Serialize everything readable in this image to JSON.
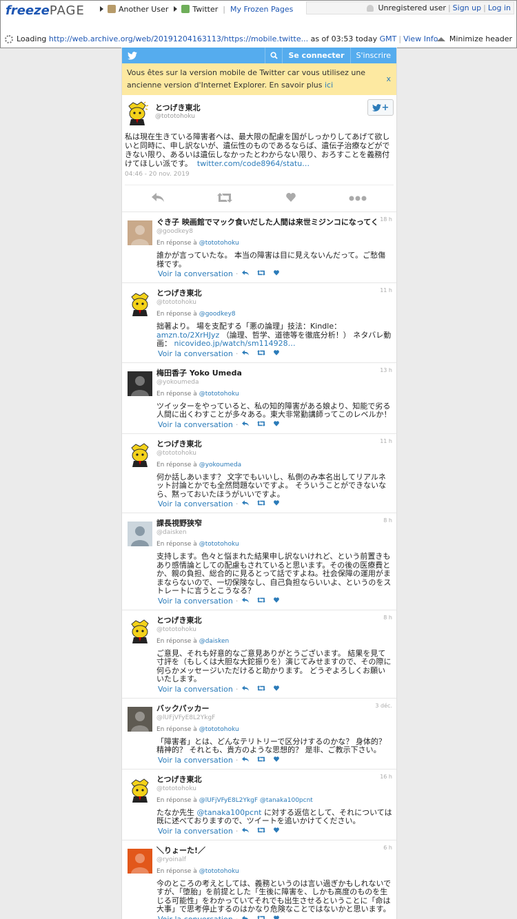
{
  "freezepage": {
    "logo_freeze": "freeze",
    "logo_page": "PAGE",
    "nav_user": "Another User",
    "nav_site": "Twitter",
    "nav_my": "My Frozen Pages",
    "user_status": "Unregistered user",
    "sign_up": "Sign up",
    "log_in": "Log in",
    "loading_label": "Loading",
    "loading_url": "http://web.archive.org/web/20191204163113/https://mobile.twitte...",
    "as_of": "as of 03:53 today",
    "gmt": "GMT",
    "view_info": "View Info",
    "minimize": "Minimize header"
  },
  "twitter": {
    "login": "Se connecter",
    "signup": "S'inscrire",
    "notice_text": "Vous êtes sur la version mobile de Twitter car vous utilisez une ancienne version d'Internet Explorer. En savoir plus",
    "notice_link": "ici",
    "notice_close": "x",
    "accent": "#55acee"
  },
  "main_tweet": {
    "name": "とつげき東北",
    "handle": "@tototohoku",
    "text": "私は現在生きている障害者へは、最大限の配慮を国がしっかりしてあげて欲しいと同時に、申し訳ないが、遺伝性のものであるならば、遺伝子治療などができない限り、あるいは遺伝しなかったとわからない限り、おろすことを義務付けてほしい派です。",
    "link": "twitter.com/code8964/statu…",
    "date": "04:46 - 20 nov. 2019"
  },
  "common": {
    "in_reply": "En réponse à",
    "view_conv": "Voir la conversation",
    "dot": "·"
  },
  "replies": [
    {
      "name": "ぐき子 映画館でマック食いだした人間は来世ミジンコになってくれ",
      "handle": "@goodkey8",
      "time": "18 h",
      "to": "@tototohoku",
      "text": "誰かが言っていたな。 本当の障害は目に見えないんだって。ご愁傷様です。",
      "link": "",
      "text2": ""
    },
    {
      "name": "とつげき東北",
      "handle": "@tototohoku",
      "time": "11 h",
      "to": "@goodkey8",
      "text": "拙著より。 場を支配する「悪の論理」技法：Kindle：",
      "link": "amzn.to/2XrHJyz",
      "text2": "（論理、哲学、道徳等を徹底分析！） ネタバレ動画："
    },
    {
      "name": "梅田香子 Yoko Umeda",
      "handle": "@yokoumeda",
      "time": "13 h",
      "to": "@tototohoku",
      "text": "ツイッターをやっていると、私の知的障害がある娘より、知能で劣る人間に出くわすことが多々ある。東大非常勤講師ってこのレベルか！",
      "link": "",
      "text2": ""
    },
    {
      "name": "とつげき東北",
      "handle": "@tototohoku",
      "time": "11 h",
      "to": "@yokoumeda",
      "text": "何か話しあいます？ 文字でもいいし、私側のみ本名出してリアルネット討論とかでも全然問題ないですよ。 そういうことができないなら、黙っておいたほうがいいですよ。",
      "link": "",
      "text2": ""
    },
    {
      "name": "課長視野狭窄",
      "handle": "@daisken",
      "time": "8 h",
      "to": "@tototohoku",
      "text": "支持します。色々と悩まれた結果申し訳ないけれど、という前置きもあり感情論としての配慮もされていると思います。その後の医療費とか、親の負担、総合的に見るとって話ですよね。社会保障の運用がままならないので、一切保険なし、自己負担ならいいよ、というのをストレートに言うとこうなる？",
      "link": "",
      "text2": ""
    },
    {
      "name": "とつげき東北",
      "handle": "@tototohoku",
      "time": "8 h",
      "to": "@daisken",
      "text": "ご意見、それも好意的なご意見ありがとうございます。 結果を見て寸評を（もしくは大胆な大鉈振りを）演じてみせますので、その際に何らかメッセージいただけると助かります。 どうぞよろしくお願いいたします。",
      "link": "",
      "text2": ""
    },
    {
      "name": "バックパッカー",
      "handle": "@lUFjVFyE8L2YkgF",
      "time": "3 déc.",
      "to": "@tototohoku",
      "text": "「障害者」とは、どんなテリトリーで区分けするのかな？ 身体的？ 精神的？ それとも、貴方のような思想的？ 是非、ご教示下さい。",
      "link": "",
      "text2": ""
    },
    {
      "name": "とつげき東北",
      "handle": "@tototohoku",
      "time": "16 h",
      "to": "@lUFjVFyE8L2YkgF @tanaka100pcnt",
      "text": "たなか先生",
      "link": "@tanaka100pcnt",
      "text2": "に対する返信として、それについては既に述べておりますので、ツイートを追いかけてください。"
    },
    {
      "name": "＼りょーた!／",
      "handle": "@ryoinalf",
      "time": "6 h",
      "to": "@tototohoku",
      "text": "今のところの考えとしては、義務というのは言い過ぎかもしれないですが、「堕胎」を前提とした「生後に障害を、しかも高度のものを生じる可能性」をわかっていてそれでも出生させるということに「命は大事」で思考停止するのはかなり危険なことではないかと思います。",
      "link": "",
      "text2": ""
    },
    {
      "name": "＼りょーた!／",
      "handle": "@ryoinalf",
      "time": "6 h",
      "to": "",
      "text": "",
      "link": "",
      "text2": ""
    }
  ],
  "reply1_link2": "nicovideo.jp/watch/sm114928…"
}
